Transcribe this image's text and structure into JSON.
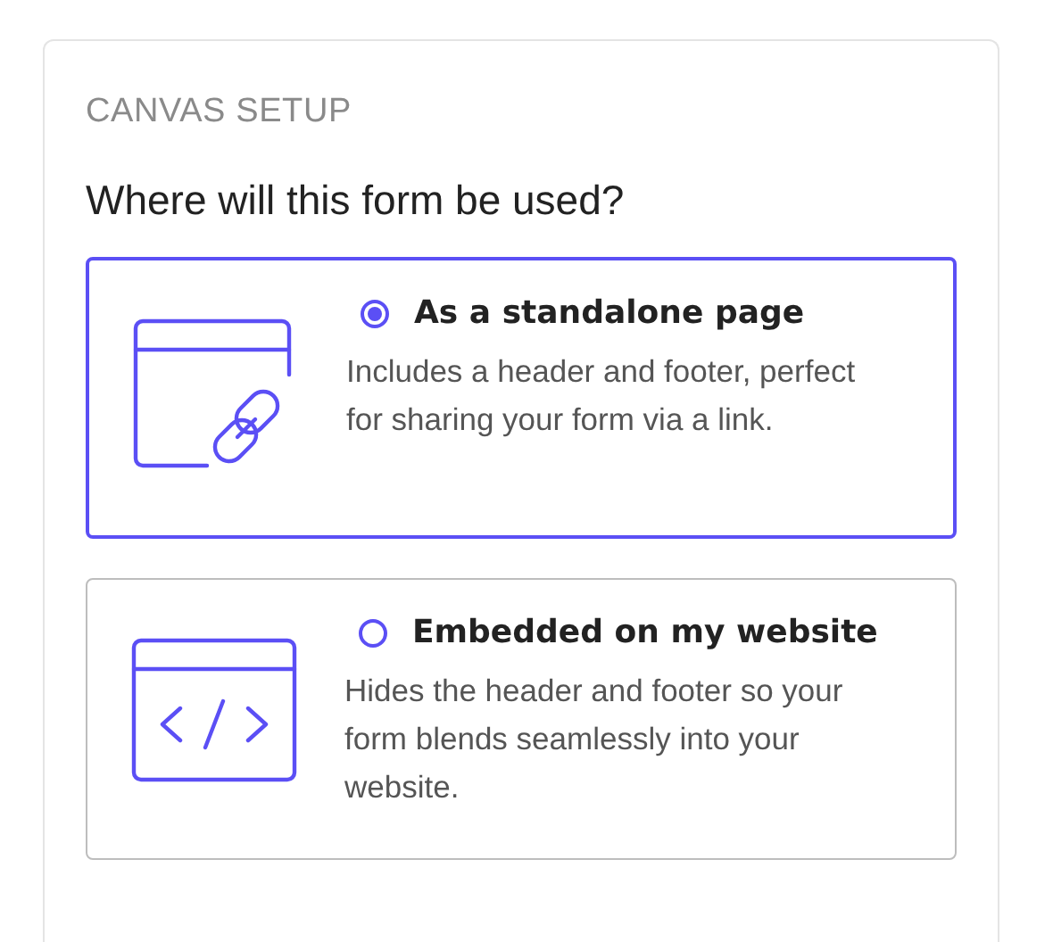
{
  "panel": {
    "heading": "CANVAS SETUP",
    "question": "Where will this form be used?"
  },
  "options": [
    {
      "kind": "standalone",
      "title": "As a standalone page",
      "description": "Includes a header and footer, perfect for sharing your form via a link.",
      "selected": true
    },
    {
      "kind": "embedded",
      "title": "Embedded on my website",
      "description": "Hides the header and footer so your form blends seamlessly into your website.",
      "selected": false
    }
  ]
}
